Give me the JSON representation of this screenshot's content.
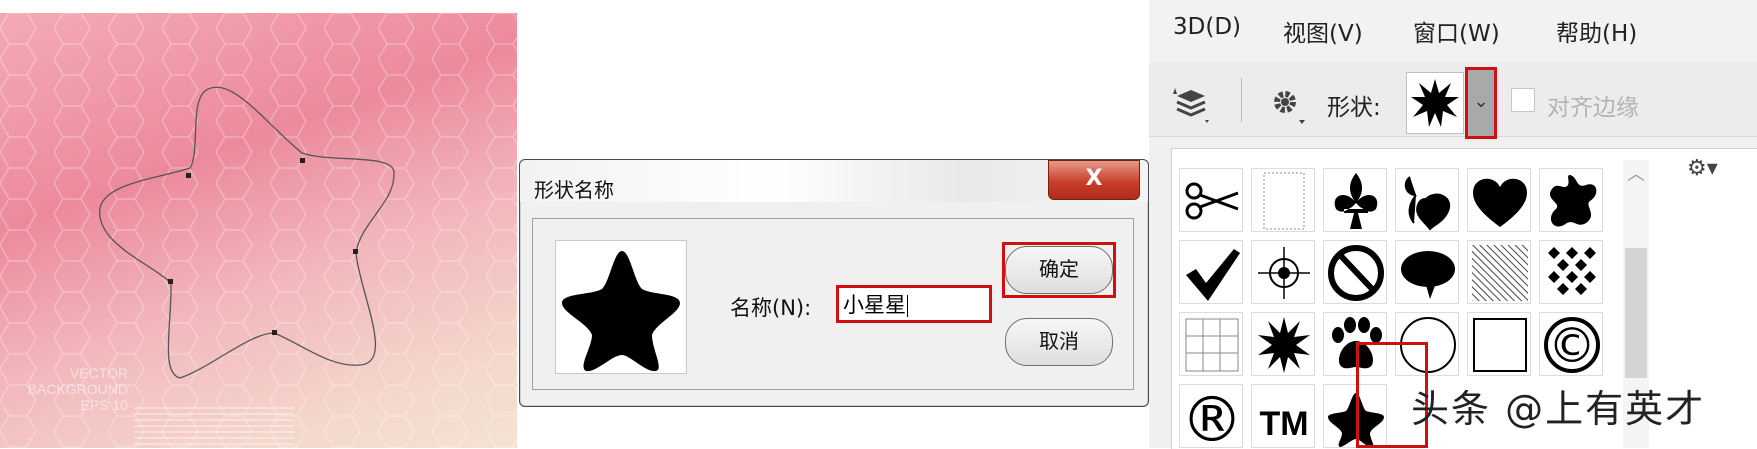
{
  "canvas": {
    "watermark_lines": [
      "VECTOR",
      "BACKGROUND",
      "EPS 10"
    ]
  },
  "dialog": {
    "title": "形状名称",
    "close_label": "X",
    "name_label": "名称(N):",
    "name_value": "小星星",
    "ok_label": "确定",
    "cancel_label": "取消"
  },
  "photoshop": {
    "menu": [
      "3D(D)",
      "视图(V)",
      "窗口(W)",
      "帮助(H)"
    ],
    "shape_label": "形状:",
    "align_edges_label": "对齐边缘",
    "align_edges_checked": false,
    "dropdown_glyph": "⌄",
    "shapes": [
      "scissors-icon",
      "blank-frame-icon",
      "fleur-de-lis-icon",
      "ornament-icon",
      "heart-icon",
      "blob-icon",
      "checkmark-icon",
      "crosshair-icon",
      "no-symbol-icon",
      "speech-bubble-icon",
      "hatch-pattern-icon",
      "dots-pattern-icon",
      "grid-icon",
      "starburst-icon",
      "paw-icon",
      "circle-icon",
      "square-icon",
      "copyright-icon",
      "registered-icon",
      "trademark-icon",
      "soft-star-icon"
    ],
    "symbols": {
      "registered": "®",
      "trademark": "TM",
      "copyright": "©"
    },
    "watermark": "头条 @上有英才"
  },
  "colors": {
    "highlight": "#d01010",
    "close_red": "#c8402c"
  }
}
